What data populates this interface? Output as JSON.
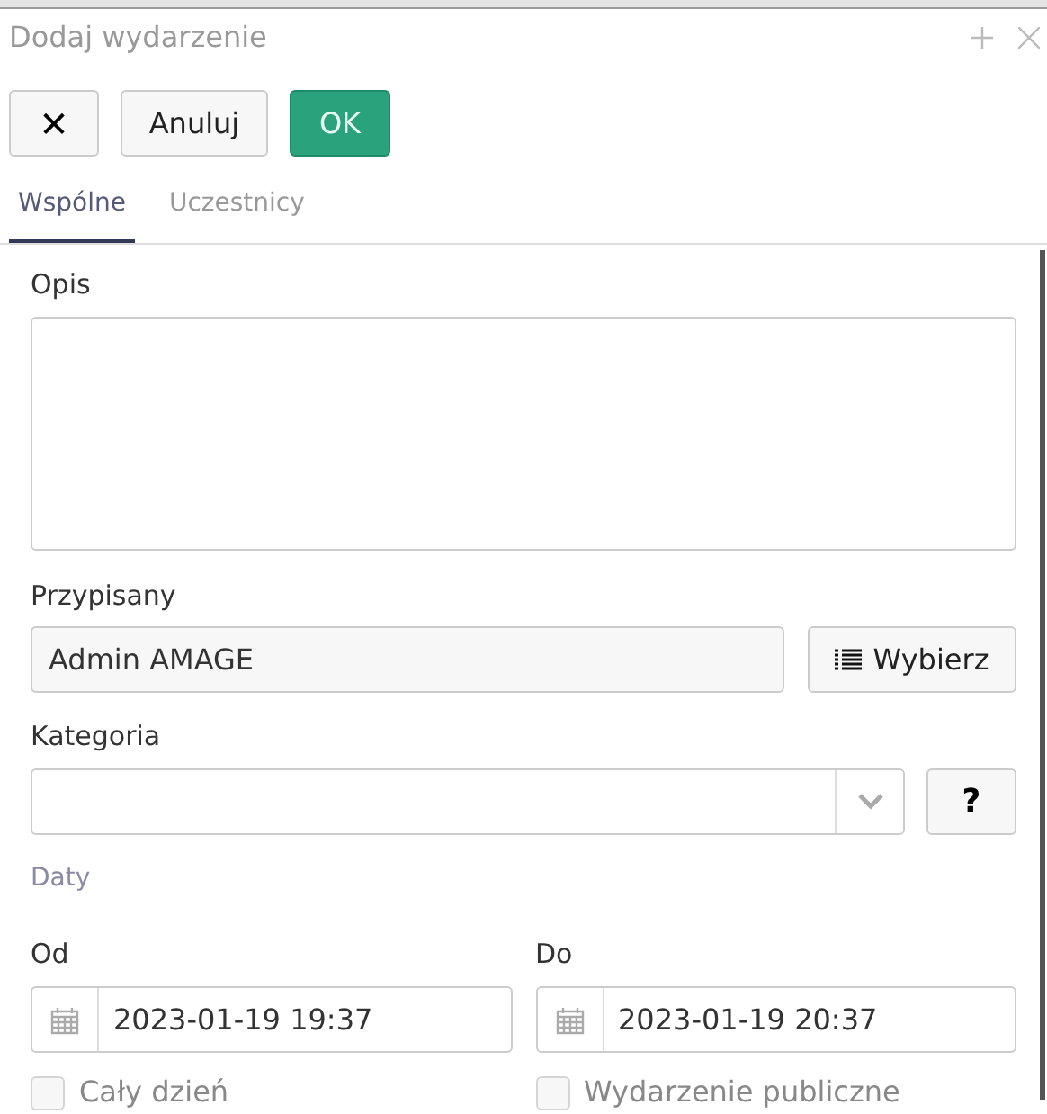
{
  "window": {
    "title": "Dodaj wydarzenie"
  },
  "toolbar": {
    "close_symbol": "✕",
    "cancel": "Anuluj",
    "ok": "OK"
  },
  "tabs": [
    {
      "label": "Wspólne",
      "selected": true
    },
    {
      "label": "Uczestnicy",
      "selected": false
    }
  ],
  "form": {
    "description": {
      "label": "Opis"
    },
    "assigned": {
      "label": "Przypisany",
      "value": "Admin AMAGE",
      "button": "Wybierz"
    },
    "category": {
      "label": "Kategoria",
      "help": "?"
    },
    "dates_section": "Daty",
    "from": {
      "label": "Od",
      "value": "2023-01-19 19:37"
    },
    "to": {
      "label": "Do",
      "value": "2023-01-19 20:37"
    },
    "checkboxes": [
      {
        "label": "Cały dzień",
        "checked": false
      },
      {
        "label": "Wydarzenie publiczne",
        "checked": false
      }
    ]
  }
}
